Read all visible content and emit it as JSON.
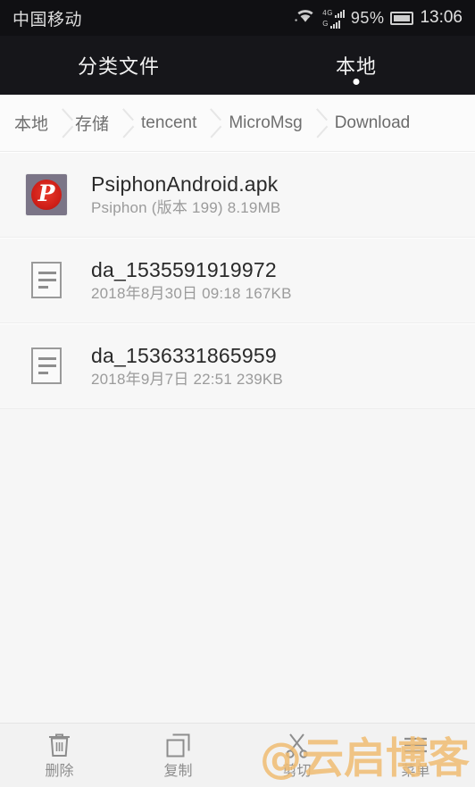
{
  "status_bar": {
    "carrier": "中国移动",
    "network_label_top": "4G",
    "network_label_bottom": "G",
    "battery_percent": "95%",
    "clock": "13:06",
    "icons": {
      "wifi": "wifi-icon",
      "signal": "signal-bars-icon",
      "battery": "battery-icon"
    }
  },
  "tabs": [
    {
      "label": "分类文件",
      "active": false
    },
    {
      "label": "本地",
      "active": true
    }
  ],
  "breadcrumb": [
    {
      "label": "本地"
    },
    {
      "label": "存储"
    },
    {
      "label": "tencent"
    },
    {
      "label": "MicroMsg"
    },
    {
      "label": "Download"
    }
  ],
  "files": [
    {
      "name": "PsiphonAndroid.apk",
      "subtitle": "Psiphon (版本 199) 8.19MB",
      "icon": "apk-icon"
    },
    {
      "name": "da_1535591919972",
      "subtitle": "2018年8月30日 09:18 167KB",
      "icon": "document-icon"
    },
    {
      "name": "da_1536331865959",
      "subtitle": "2018年9月7日 22:51 239KB",
      "icon": "document-icon"
    }
  ],
  "toolbar": [
    {
      "label": "删除",
      "icon": "trash-icon"
    },
    {
      "label": "复制",
      "icon": "copy-icon"
    },
    {
      "label": "剪切",
      "icon": "scissors-icon"
    },
    {
      "label": "菜单",
      "icon": "menu-icon"
    }
  ],
  "watermark": "@云启博客",
  "colors": {
    "status_bar_bg": "#101013",
    "tab_bar_bg": "#16161a",
    "page_bg": "#f6f6f6",
    "row_bg": "#f7f7f7",
    "toolbar_bg": "#f2f2f2",
    "apk_accent": "#cf1f18",
    "watermark": "#f0bd72"
  }
}
